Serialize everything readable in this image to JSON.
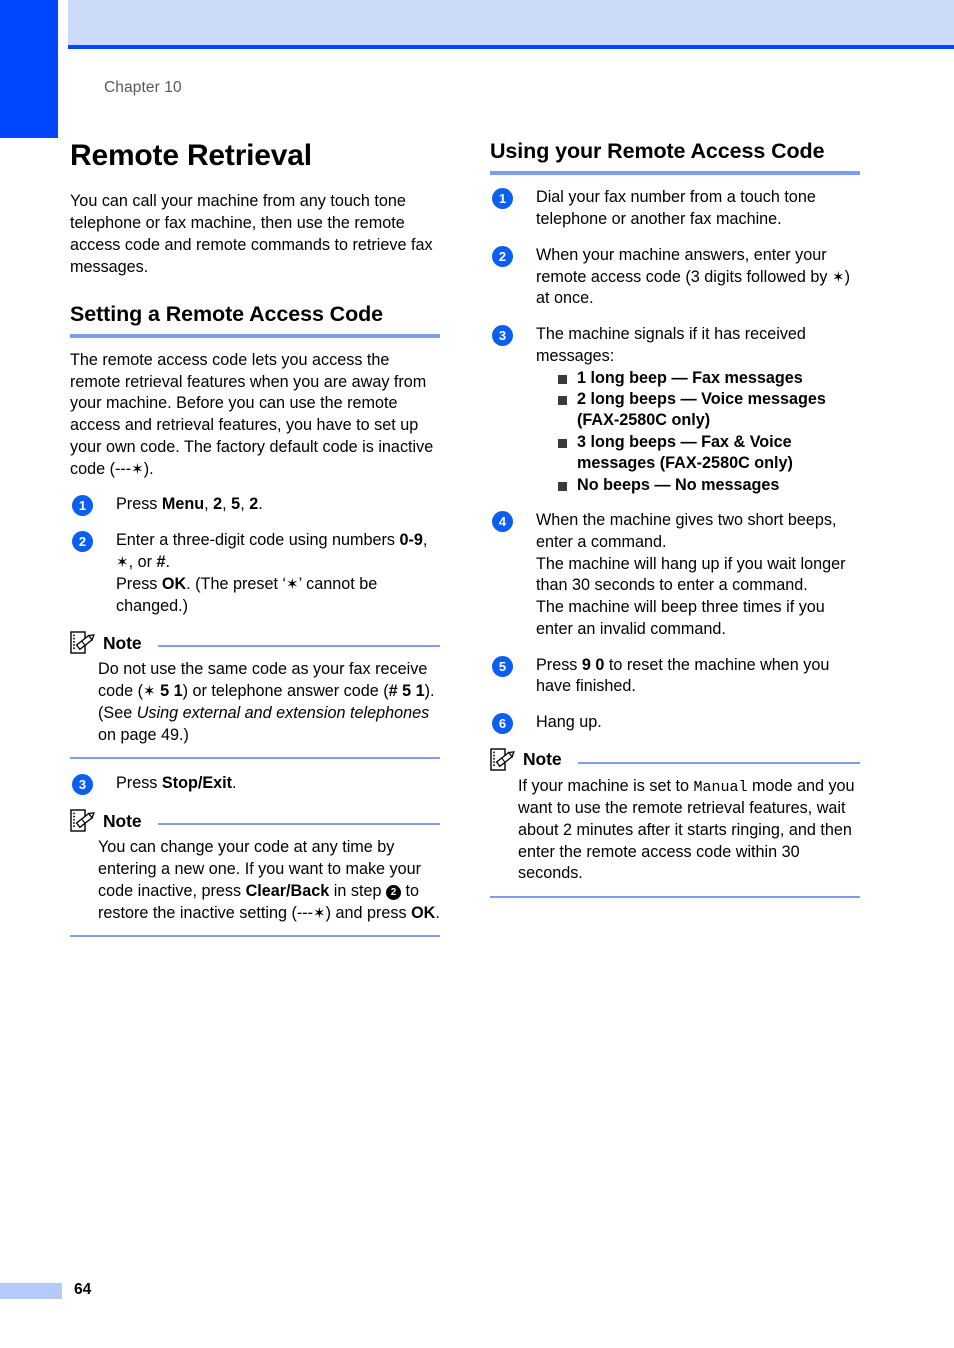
{
  "page": {
    "chapter_label": "Chapter 10",
    "page_number": "64",
    "accent_blue": "#0047ff",
    "header_band_blue": "#cddbfb",
    "rule_blue": "#7b9ff0",
    "step_circle_blue": "#0a5ef0",
    "footer_bar_blue": "#b4caf8"
  },
  "left_column": {
    "title": "Remote Retrieval",
    "intro": "You can call your machine from any touch tone telephone or fax machine, then use the remote access code and remote commands to retrieve fax messages.",
    "section": {
      "heading": "Setting a Remote Access Code",
      "paragraph_prefix": "The remote access code lets you access the remote retrieval features when you are away from your machine. Before you can use the remote access and retrieval features, you have to set up your own code. The factory default code is inactive code (---",
      "paragraph_suffix": ").",
      "asterisk": "✶",
      "steps": [
        {
          "num": "1",
          "lines": [
            {
              "segments": [
                {
                  "text": "Press ",
                  "style": "normal"
                },
                {
                  "text": "Menu",
                  "style": "bold"
                },
                {
                  "text": ", ",
                  "style": "normal"
                },
                {
                  "text": "2",
                  "style": "bold"
                },
                {
                  "text": ", ",
                  "style": "normal"
                },
                {
                  "text": "5",
                  "style": "bold"
                },
                {
                  "text": ", ",
                  "style": "normal"
                },
                {
                  "text": "2",
                  "style": "bold"
                },
                {
                  "text": ".",
                  "style": "normal"
                }
              ]
            }
          ]
        },
        {
          "num": "2",
          "lines": [
            {
              "segments": [
                {
                  "text": "Enter a three-digit code using numbers ",
                  "style": "normal"
                },
                {
                  "text": "0-9",
                  "style": "bold"
                },
                {
                  "text": ", ",
                  "style": "normal"
                },
                {
                  "text": "✶",
                  "style": "asterisk"
                },
                {
                  "text": ", or ",
                  "style": "normal"
                },
                {
                  "text": "#",
                  "style": "bold"
                },
                {
                  "text": ".",
                  "style": "normal"
                }
              ]
            },
            {
              "segments": [
                {
                  "text": "Press ",
                  "style": "normal"
                },
                {
                  "text": "OK",
                  "style": "bold"
                },
                {
                  "text": ". (The preset ‘",
                  "style": "normal"
                },
                {
                  "text": "✶",
                  "style": "asterisk"
                },
                {
                  "text": "’ cannot be changed.)",
                  "style": "normal"
                }
              ]
            }
          ]
        }
      ],
      "note_one": {
        "title": "Note",
        "segments": [
          {
            "text": "Do not use the same code as your fax receive code (",
            "style": "normal"
          },
          {
            "text": "✶",
            "style": "asterisk"
          },
          {
            "text": " 5 1",
            "style": "bold"
          },
          {
            "text": ") or telephone answer code (",
            "style": "normal"
          },
          {
            "text": "# 5 1",
            "style": "bold"
          },
          {
            "text": "). (See ",
            "style": "normal"
          },
          {
            "text": "Using external and extension telephones",
            "style": "italic"
          },
          {
            "text": " on page 49.)",
            "style": "normal"
          }
        ]
      },
      "step_three": {
        "num": "3",
        "segments": [
          {
            "text": "Press ",
            "style": "normal"
          },
          {
            "text": "Stop/Exit",
            "style": "bold"
          },
          {
            "text": ".",
            "style": "normal"
          }
        ]
      },
      "note_two": {
        "title": "Note",
        "segments": [
          {
            "text": "You can change your code at any time by entering a new one. If you want to make your code inactive, press ",
            "style": "normal"
          },
          {
            "text": "Clear/Back",
            "style": "bold"
          },
          {
            "text": " in step ",
            "style": "normal"
          },
          {
            "text": "2",
            "style": "inline-circle"
          },
          {
            "text": " to restore the inactive setting (---",
            "style": "normal"
          },
          {
            "text": "✶",
            "style": "asterisk"
          },
          {
            "text": ") and press ",
            "style": "normal"
          },
          {
            "text": "OK",
            "style": "bold"
          },
          {
            "text": ".",
            "style": "normal"
          }
        ]
      }
    }
  },
  "right_column": {
    "heading": "Using your Remote Access Code",
    "steps": [
      {
        "num": "1",
        "lines": [
          {
            "segments": [
              {
                "text": "Dial your fax number from a touch tone telephone or another fax machine.",
                "style": "normal"
              }
            ]
          }
        ]
      },
      {
        "num": "2",
        "lines": [
          {
            "segments": [
              {
                "text": "When your machine answers, enter your remote access code (3 digits followed by ",
                "style": "normal"
              },
              {
                "text": "✶",
                "style": "asterisk"
              },
              {
                "text": ") at once.",
                "style": "normal"
              }
            ]
          }
        ]
      },
      {
        "num": "3",
        "lines": [
          {
            "segments": [
              {
                "text": "The machine signals if it has received messages:",
                "style": "normal"
              }
            ]
          }
        ],
        "bullets": [
          "1 long beep — Fax messages",
          "2 long beeps — Voice messages (FAX-2580C only)",
          "3 long beeps — Fax & Voice messages (FAX-2580C only)",
          "No beeps — No messages"
        ]
      },
      {
        "num": "4",
        "lines": [
          {
            "segments": [
              {
                "text": "When the machine gives two short beeps, enter a command.",
                "style": "normal"
              }
            ]
          },
          {
            "segments": [
              {
                "text": "The machine will hang up if you wait longer than 30 seconds to enter a command.",
                "style": "normal"
              }
            ]
          },
          {
            "segments": [
              {
                "text": "The machine will beep three times if you enter an invalid command.",
                "style": "normal"
              }
            ]
          }
        ]
      },
      {
        "num": "5",
        "lines": [
          {
            "segments": [
              {
                "text": "Press ",
                "style": "normal"
              },
              {
                "text": "9 0",
                "style": "bold"
              },
              {
                "text": " to reset the machine when you have finished.",
                "style": "normal"
              }
            ]
          }
        ]
      },
      {
        "num": "6",
        "lines": [
          {
            "segments": [
              {
                "text": "Hang up.",
                "style": "normal"
              }
            ]
          }
        ]
      }
    ],
    "note": {
      "title": "Note",
      "segments": [
        {
          "text": "If your machine is set to ",
          "style": "normal"
        },
        {
          "text": "Manual",
          "style": "mono"
        },
        {
          "text": " mode and you want to use the remote retrieval features, wait about 2 minutes after it starts ringing, and then enter the remote access code within 30 seconds.",
          "style": "normal"
        }
      ]
    }
  }
}
